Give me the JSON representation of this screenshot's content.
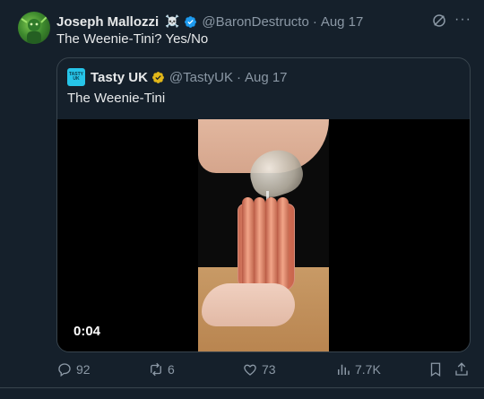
{
  "tweet": {
    "author_name": "Joseph Mallozzi",
    "author_emoji": "☠️",
    "handle": "@BaronDestructo",
    "separator": "·",
    "date": "Aug 17",
    "text": "The Weenie-Tini?  Yes/No",
    "more_icon": "···"
  },
  "quote": {
    "author_name": "Tasty UK",
    "avatar_line1": "TASTY",
    "avatar_line2": "UK",
    "handle": "@TastyUK",
    "separator": "·",
    "date": "Aug 17",
    "text": "The Weenie-Tini",
    "video_timestamp": "0:04"
  },
  "actions": {
    "replies": "92",
    "reposts": "6",
    "likes": "73",
    "views": "7.7K"
  },
  "colors": {
    "background": "#15202b",
    "verified_blue": "#1d9bf0",
    "verified_gold": "#e2b719",
    "muted": "#8b98a5"
  }
}
